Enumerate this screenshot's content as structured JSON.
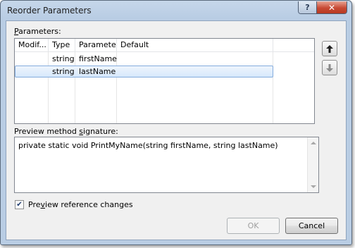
{
  "dialog": {
    "title": "Reorder Parameters",
    "help_glyph": "?",
    "close_glyph": "✕"
  },
  "parameters": {
    "label_key": "P",
    "label_rest": "arameters:",
    "columns": [
      "Modif...",
      "Type",
      "Parameter",
      "Default"
    ],
    "rows": [
      {
        "modifier": "",
        "type": "string",
        "parameter": "firstName",
        "default": "",
        "selected": false
      },
      {
        "modifier": "",
        "type": "string",
        "parameter": "lastName",
        "default": "",
        "selected": true
      }
    ],
    "move_up_icon": "▲",
    "move_down_icon": "▼"
  },
  "preview": {
    "label_before": "Preview method ",
    "label_key": "s",
    "label_after": "ignature:",
    "signature": "private static void PrintMyName(string firstName, string lastName)"
  },
  "options": {
    "preview_changes_checked": true,
    "preview_changes_before": "Pre",
    "preview_changes_key": "v",
    "preview_changes_after": "iew reference changes"
  },
  "buttons": {
    "ok": "OK",
    "cancel": "Cancel"
  },
  "colors": {
    "selection_border": "#84acdd",
    "title_bar": "#b9cde4"
  }
}
